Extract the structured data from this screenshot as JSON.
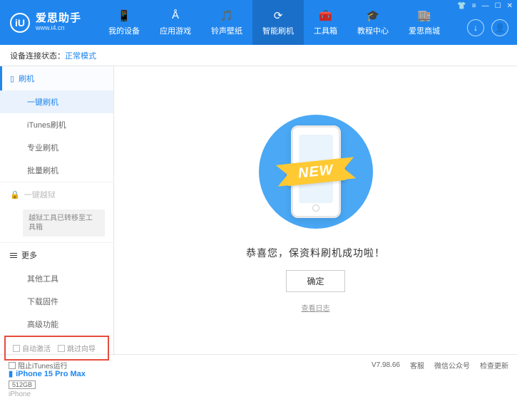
{
  "header": {
    "logo_char": "iU",
    "title": "爱思助手",
    "url": "www.i4.cn",
    "nav": [
      {
        "icon": "📱",
        "label": "我的设备"
      },
      {
        "icon": "Å",
        "label": "应用游戏"
      },
      {
        "icon": "🎵",
        "label": "铃声壁纸"
      },
      {
        "icon": "⟳",
        "label": "智能刷机"
      },
      {
        "icon": "🧰",
        "label": "工具箱"
      },
      {
        "icon": "🎓",
        "label": "教程中心"
      },
      {
        "icon": "🏬",
        "label": "爱思商城"
      }
    ],
    "win": {
      "skin": "👕",
      "menu": "≡",
      "min": "—",
      "max": "☐",
      "close": "✕"
    },
    "right_icons": {
      "download": "↓",
      "user": "👤"
    }
  },
  "status": {
    "label": "设备连接状态：",
    "value": "正常模式"
  },
  "sidebar": {
    "flash": {
      "header": "刷机",
      "items": [
        "一键刷机",
        "iTunes刷机",
        "专业刷机",
        "批量刷机"
      ]
    },
    "jailbreak": {
      "header": "一键越狱",
      "note": "越狱工具已转移至工具箱"
    },
    "more": {
      "header": "更多",
      "items": [
        "其他工具",
        "下载固件",
        "高级功能"
      ]
    },
    "checks": {
      "auto_activate": "自动激活",
      "skip_guide": "跳过向导"
    },
    "device": {
      "name": "iPhone 15 Pro Max",
      "storage": "512GB",
      "type": "iPhone"
    }
  },
  "main": {
    "ribbon": "NEW",
    "message": "恭喜您，保资料刷机成功啦！",
    "ok": "确定",
    "log": "查看日志"
  },
  "footer": {
    "block_itunes": "阻止iTunes运行",
    "version": "V7.98.66",
    "links": [
      "客服",
      "微信公众号",
      "检查更新"
    ]
  }
}
